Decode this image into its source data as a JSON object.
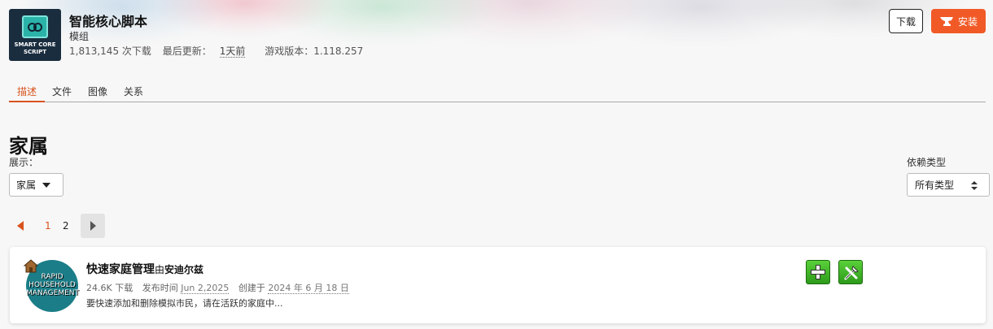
{
  "mod": {
    "title": "智能核心脚本",
    "type": "模组",
    "logo_text": "SMART CORE SCRIPT",
    "downloads": "1,813,145 次下载",
    "last_update_label": "最后更新：",
    "last_update_value": "1天前",
    "game_version": "游戏版本：1.118.257"
  },
  "actions": {
    "download_label": "下载",
    "install_label": "安装",
    "install_icon": "curseforge-anvil-icon"
  },
  "tabs": [
    {
      "label": "描述",
      "active": true
    },
    {
      "label": "文件",
      "active": false
    },
    {
      "label": "图像",
      "active": false
    },
    {
      "label": "关系",
      "active": false
    }
  ],
  "section": {
    "title": "家属",
    "show_label": "展示：",
    "show_value": "家属",
    "dep_type_label": "依赖类型",
    "dep_type_value": "所有类型"
  },
  "pagination": {
    "pages": [
      "1",
      "2"
    ],
    "current": "1"
  },
  "results": [
    {
      "title": "快速家庭管理",
      "by": "由",
      "author": "安迪尔兹",
      "logo_text": "RAPID HOUSEHOLD MANAGEMENT",
      "downloads": "24.6K 下载",
      "published_label": "发布时间",
      "published_value": "Jun 2,2025",
      "created_label": "创建于",
      "created_value": "2024 年 6 月 18 日",
      "description": "要快速添加和删除模拟市民，请在活跃的家庭中...",
      "action_icons": [
        "plus-icon",
        "tools-icon"
      ]
    }
  ],
  "colors": {
    "accent": "#f15a27",
    "active_tab": "#d9531e",
    "action_green": "#3cb524"
  }
}
